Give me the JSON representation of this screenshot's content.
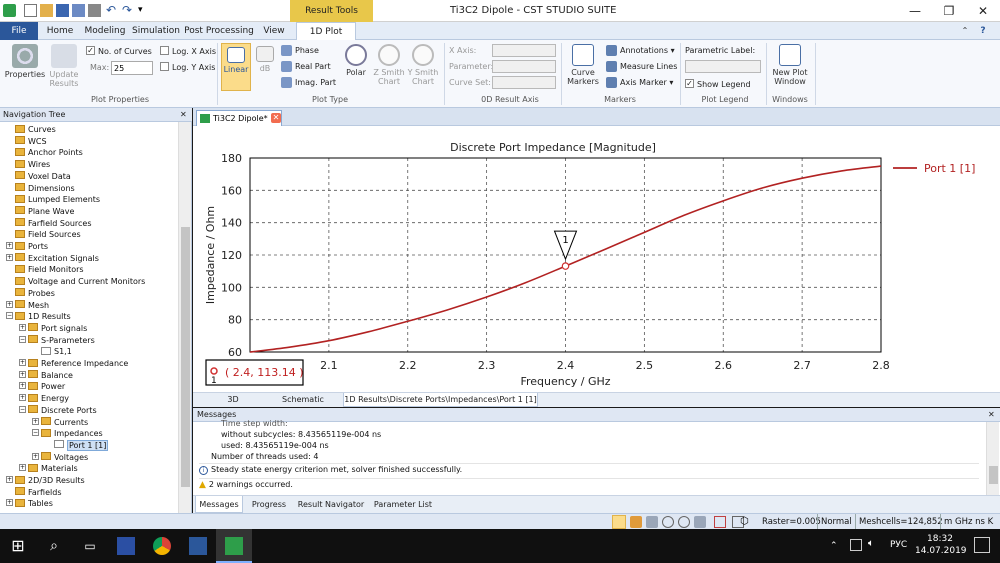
{
  "window": {
    "title": "Ti3C2 Dipole - CST STUDIO SUITE",
    "context_tab": "Result Tools",
    "minimize": "—",
    "restore": "❐",
    "close": "✕"
  },
  "menu_tabs": [
    "File",
    "Home",
    "Modeling",
    "Simulation",
    "Post Processing",
    "View",
    "1D Plot"
  ],
  "ribbon": {
    "properties": "Properties",
    "update_results": "Update Results",
    "no_of_curves": "No. of Curves",
    "max_label": "Max:",
    "max_value": "25",
    "log_x": "Log. X Axis",
    "log_y": "Log. Y Axis",
    "group_plot_properties": "Plot Properties",
    "linear": "Linear",
    "db": "dB",
    "phase": "Phase",
    "real_part": "Real Part",
    "imag_part": "Imag. Part",
    "polar": "Polar",
    "z_smith": "Z Smith Chart",
    "y_smith": "Y Smith Chart",
    "group_plot_type": "Plot Type",
    "x_axis": "X Axis:",
    "parameter": "Parameter:",
    "curve_set": "Curve Set:",
    "group_0d": "0D Result Axis",
    "curve_markers": "Curve Markers",
    "annotations": "Annotations",
    "measure_lines": "Measure Lines",
    "axis_marker": "Axis Marker",
    "group_markers": "Markers",
    "parametric_label": "Parametric Label:",
    "show_legend": "Show Legend",
    "group_plot_legend": "Plot Legend",
    "new_plot_window": "New Plot Window",
    "group_windows": "Windows"
  },
  "nav": {
    "title": "Navigation Tree",
    "close": "✕",
    "items": [
      {
        "label": "Curves",
        "indent": 0,
        "expander": ""
      },
      {
        "label": "WCS",
        "indent": 0,
        "expander": ""
      },
      {
        "label": "Anchor Points",
        "indent": 0,
        "expander": ""
      },
      {
        "label": "Wires",
        "indent": 0,
        "expander": ""
      },
      {
        "label": "Voxel Data",
        "indent": 0,
        "expander": ""
      },
      {
        "label": "Dimensions",
        "indent": 0,
        "expander": ""
      },
      {
        "label": "Lumped Elements",
        "indent": 0,
        "expander": ""
      },
      {
        "label": "Plane Wave",
        "indent": 0,
        "expander": ""
      },
      {
        "label": "Farfield Sources",
        "indent": 0,
        "expander": ""
      },
      {
        "label": "Field Sources",
        "indent": 0,
        "expander": ""
      },
      {
        "label": "Ports",
        "indent": 0,
        "expander": "+"
      },
      {
        "label": "Excitation Signals",
        "indent": 0,
        "expander": "+"
      },
      {
        "label": "Field Monitors",
        "indent": 0,
        "expander": ""
      },
      {
        "label": "Voltage and Current Monitors",
        "indent": 0,
        "expander": ""
      },
      {
        "label": "Probes",
        "indent": 0,
        "expander": ""
      },
      {
        "label": "Mesh",
        "indent": 0,
        "expander": "+"
      },
      {
        "label": "1D Results",
        "indent": 0,
        "expander": "−"
      },
      {
        "label": "Port signals",
        "indent": 1,
        "expander": "+"
      },
      {
        "label": "S-Parameters",
        "indent": 1,
        "expander": "−"
      },
      {
        "label": "S1,1",
        "indent": 2,
        "expander": ""
      },
      {
        "label": "Reference Impedance",
        "indent": 1,
        "expander": "+"
      },
      {
        "label": "Balance",
        "indent": 1,
        "expander": "+"
      },
      {
        "label": "Power",
        "indent": 1,
        "expander": "+"
      },
      {
        "label": "Energy",
        "indent": 1,
        "expander": "+"
      },
      {
        "label": "Discrete Ports",
        "indent": 1,
        "expander": "−"
      },
      {
        "label": "Currents",
        "indent": 2,
        "expander": "+"
      },
      {
        "label": "Impedances",
        "indent": 2,
        "expander": "−"
      },
      {
        "label": "Port 1 [1]",
        "indent": 3,
        "expander": "",
        "selected": true
      },
      {
        "label": "Voltages",
        "indent": 2,
        "expander": "+"
      },
      {
        "label": "Materials",
        "indent": 1,
        "expander": "+"
      },
      {
        "label": "2D/3D Results",
        "indent": 0,
        "expander": "+"
      },
      {
        "label": "Farfields",
        "indent": 0,
        "expander": ""
      },
      {
        "label": "Tables",
        "indent": 0,
        "expander": "+"
      }
    ]
  },
  "doc_tab": {
    "label": "Ti3C2 Dipole*",
    "close": "✕"
  },
  "chart_data": {
    "type": "line",
    "title": "Discrete Port Impedance [Magnitude]",
    "xlabel": "Frequency / GHz",
    "ylabel": "Impedance / Ohm",
    "xlim": [
      2.0,
      2.8
    ],
    "ylim": [
      60,
      180
    ],
    "xticks": [
      "2.1",
      "2.2",
      "2.3",
      "2.4",
      "2.5",
      "2.6",
      "2.7",
      "2.8"
    ],
    "yticks": [
      "60",
      "80",
      "100",
      "120",
      "140",
      "160",
      "180"
    ],
    "grid": "dashed",
    "legend_position": "right",
    "series": [
      {
        "name": "Port 1 [1]",
        "color": "#b22222",
        "x": [
          2.0,
          2.05,
          2.1,
          2.15,
          2.2,
          2.25,
          2.3,
          2.35,
          2.4,
          2.45,
          2.5,
          2.55,
          2.6,
          2.65,
          2.7,
          2.75,
          2.8
        ],
        "y": [
          60.0,
          63.0,
          67.0,
          72.5,
          79.0,
          86.0,
          94.0,
          103.0,
          113.14,
          123.5,
          134.0,
          144.5,
          153.5,
          161.5,
          167.5,
          172.0,
          175.0
        ]
      }
    ],
    "marker": {
      "id": "1",
      "x": 2.4,
      "y": 113.14,
      "label": "( 2.4, 113.14 )",
      "label_id": "1"
    }
  },
  "view_tabs": [
    {
      "label": "3D"
    },
    {
      "label": "Schematic"
    },
    {
      "label": "1D Results\\Discrete Ports\\Impedances\\Port 1 [1]",
      "active": true
    }
  ],
  "messages": {
    "title": "Messages",
    "close": "✕",
    "lines": [
      "Time step width:",
      "without subcycles: 8.43565119e-004 ns",
      "used: 8.43565119e-004 ns",
      "Number of threads used: 4",
      "Steady state energy criterion met, solver finished successfully.",
      "2 warnings occurred."
    ],
    "tabs": [
      "Messages",
      "Progress",
      "Result Navigator",
      "Parameter List"
    ]
  },
  "status": {
    "raster": "Raster=0.005",
    "mode": "Normal",
    "meshcells": "Meshcells=124,852",
    "units": "m  GHz  ns  K"
  },
  "taskbar": {
    "lang": "РУС",
    "time": "18:32",
    "date": "14.07.2019"
  }
}
